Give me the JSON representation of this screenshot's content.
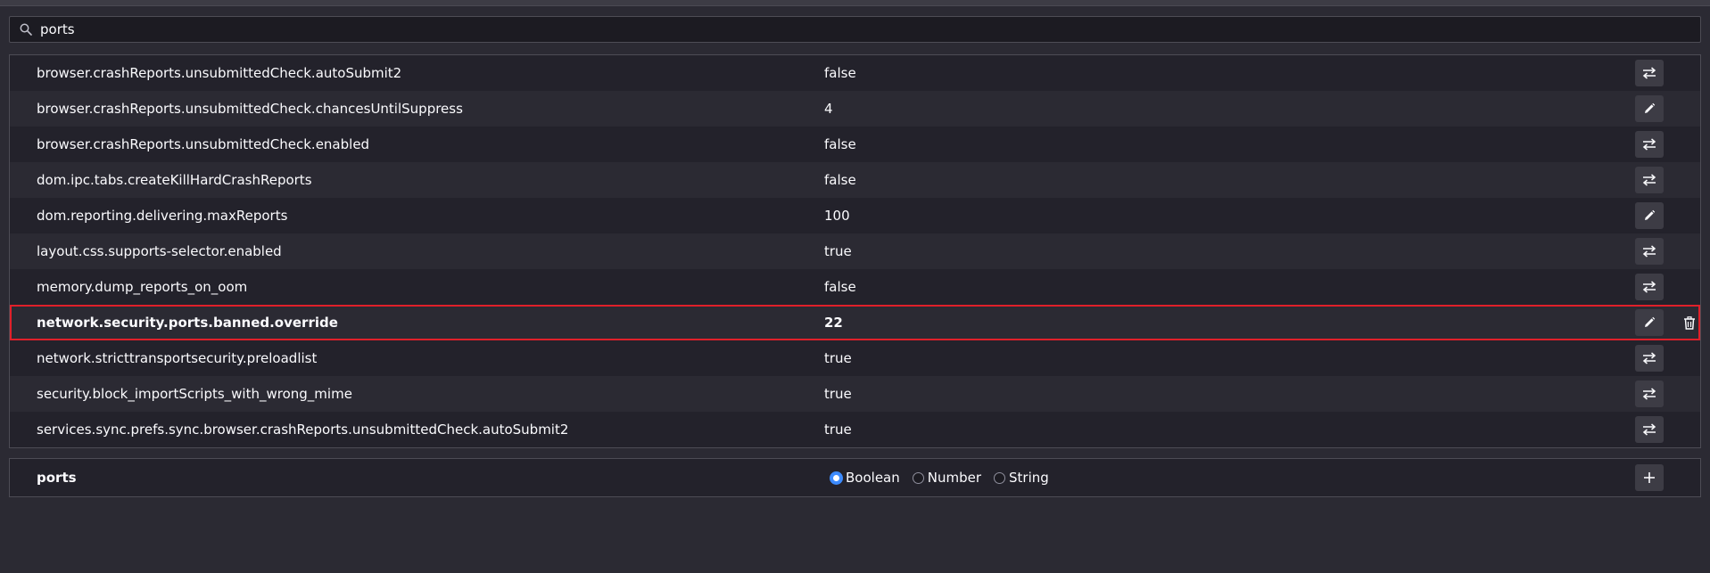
{
  "search": {
    "value": "ports",
    "icon": "search-icon"
  },
  "prefs": [
    {
      "name": "browser.crashReports.unsubmittedCheck.autoSubmit2",
      "value": "false",
      "action": "toggle",
      "modified": false
    },
    {
      "name": "browser.crashReports.unsubmittedCheck.chancesUntilSuppress",
      "value": "4",
      "action": "edit",
      "modified": false
    },
    {
      "name": "browser.crashReports.unsubmittedCheck.enabled",
      "value": "false",
      "action": "toggle",
      "modified": false
    },
    {
      "name": "dom.ipc.tabs.createKillHardCrashReports",
      "value": "false",
      "action": "toggle",
      "modified": false
    },
    {
      "name": "dom.reporting.delivering.maxReports",
      "value": "100",
      "action": "edit",
      "modified": false
    },
    {
      "name": "layout.css.supports-selector.enabled",
      "value": "true",
      "action": "toggle",
      "modified": false
    },
    {
      "name": "memory.dump_reports_on_oom",
      "value": "false",
      "action": "toggle",
      "modified": false
    },
    {
      "name": "network.security.ports.banned.override",
      "value": "22",
      "action": "edit",
      "modified": true
    },
    {
      "name": "network.stricttransportsecurity.preloadlist",
      "value": "true",
      "action": "toggle",
      "modified": false
    },
    {
      "name": "security.block_importScripts_with_wrong_mime",
      "value": "true",
      "action": "toggle",
      "modified": false
    },
    {
      "name": "services.sync.prefs.sync.browser.crashReports.unsubmittedCheck.autoSubmit2",
      "value": "true",
      "action": "toggle",
      "modified": false
    }
  ],
  "add_pref": {
    "name": "ports",
    "types": [
      {
        "label": "Boolean",
        "checked": true
      },
      {
        "label": "Number",
        "checked": false
      },
      {
        "label": "String",
        "checked": false
      }
    ]
  },
  "colors": {
    "background": "#2b2a33",
    "row_alt": "#23222b",
    "highlight_border": "#e0202a",
    "radio_accent": "#3d8bfd"
  }
}
